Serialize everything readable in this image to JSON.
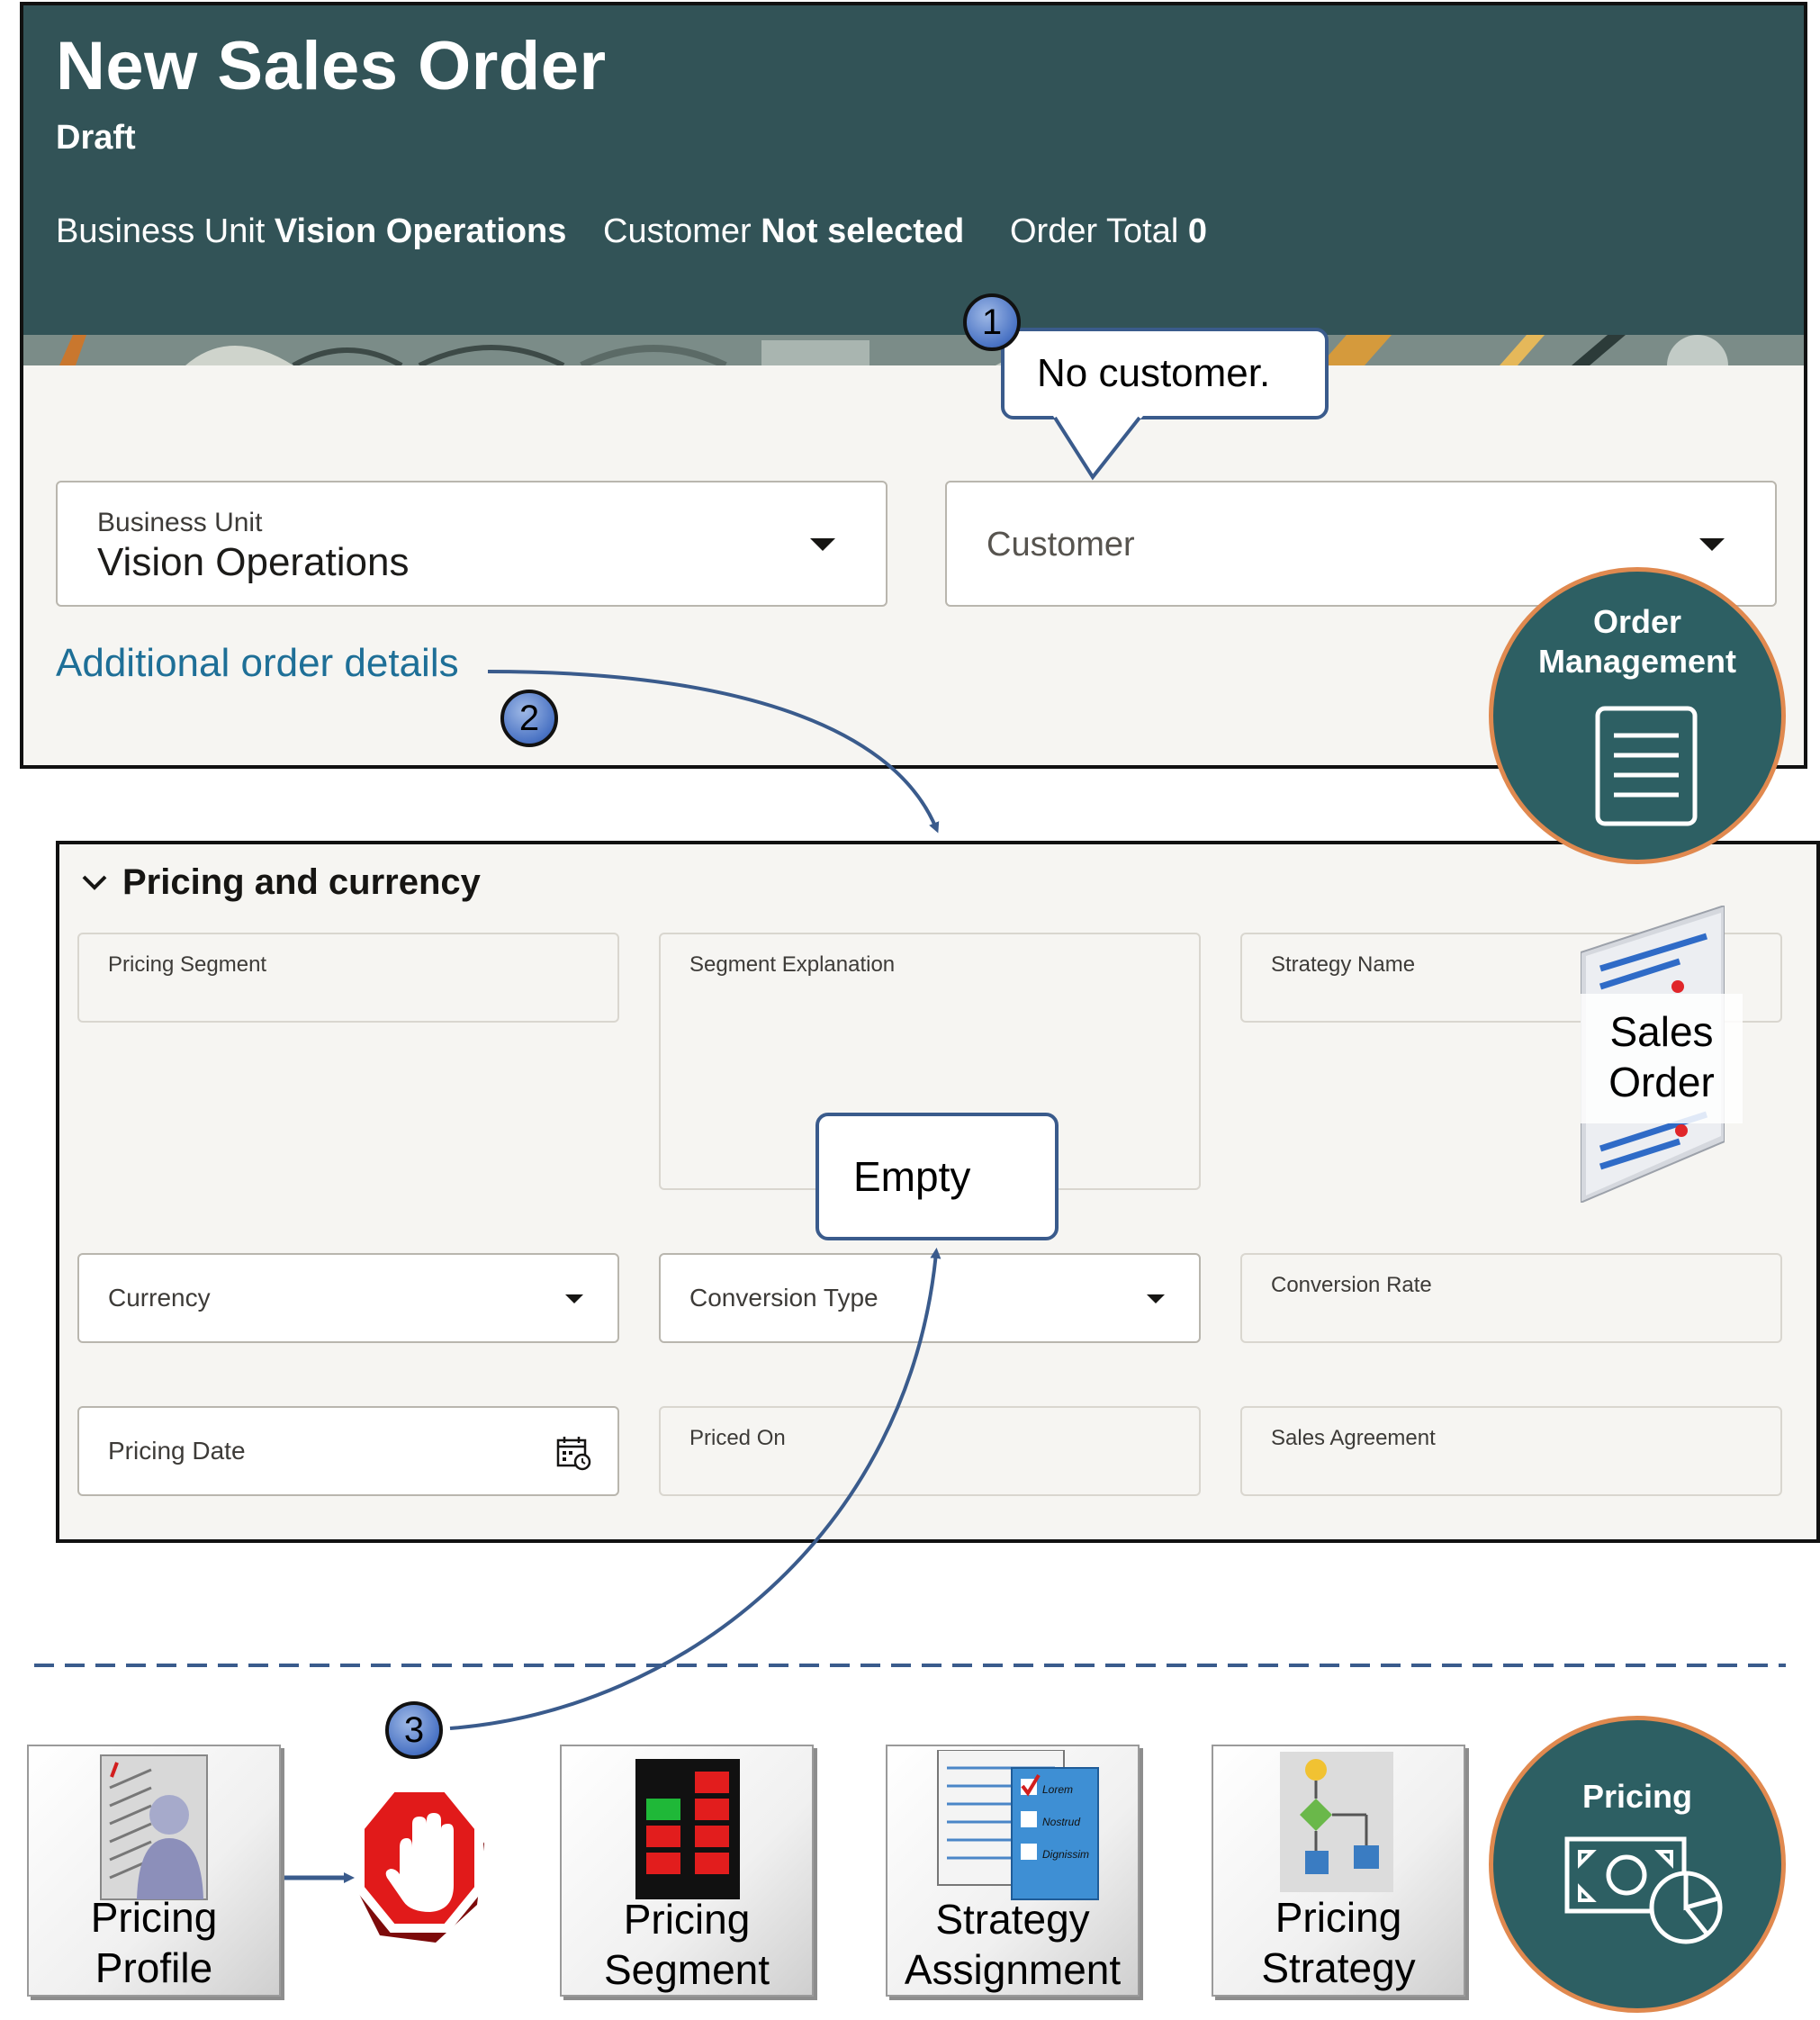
{
  "header": {
    "title": "New Sales Order",
    "status": "Draft",
    "business_unit_label": "Business Unit",
    "business_unit_value": "Vision Operations",
    "customer_label": "Customer",
    "customer_value": "Not selected",
    "order_total_label": "Order Total",
    "order_total_value": "0"
  },
  "form": {
    "business_unit_label": "Business Unit",
    "business_unit_value": "Vision Operations",
    "customer_placeholder": "Customer",
    "additional_link": "Additional order details"
  },
  "callouts": {
    "badge1": "1",
    "badge2": "2",
    "badge3": "3",
    "no_customer": "No customer.",
    "empty": "Empty"
  },
  "om_circle": {
    "line1": "Order",
    "line2": "Management"
  },
  "sales_order_tag": {
    "line1": "Sales",
    "line2": "Order"
  },
  "pricing_section": {
    "title": "Pricing and currency",
    "pricing_segment": "Pricing Segment",
    "segment_explanation": "Segment Explanation",
    "strategy_name": "Strategy Name",
    "currency": "Currency",
    "conversion_type": "Conversion Type",
    "conversion_rate": "Conversion Rate",
    "pricing_date": "Pricing Date",
    "priced_on": "Priced On",
    "sales_agreement": "Sales Agreement"
  },
  "flow": {
    "pricing_profile": [
      "Pricing",
      "Profile"
    ],
    "pricing_segment": [
      "Pricing",
      "Segment"
    ],
    "strategy_assignment": [
      "Strategy",
      "Assignment"
    ],
    "pricing_strategy": [
      "Pricing",
      "Strategy"
    ],
    "pricing_circle": "Pricing",
    "checklist_items": [
      "Lorem",
      "Nostrud",
      "Dignissim"
    ]
  },
  "colors": {
    "header_bg": "#325357",
    "link": "#1e6f97",
    "circle_fill": "#2d5f63",
    "circle_ring": "#e0894f",
    "arrow": "#3a5b8c"
  },
  "icons": [
    "chevron-down-icon",
    "calendar-icon",
    "document-icon",
    "stop-hand-icon",
    "pricing-icon"
  ]
}
